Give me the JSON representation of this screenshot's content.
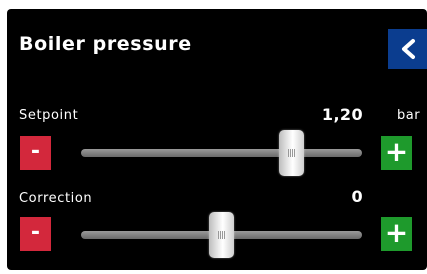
{
  "header": {
    "title": "Boiler pressure",
    "back_icon": "chevron-left-icon"
  },
  "params": [
    {
      "label": "Setpoint",
      "value": "1,20",
      "unit": "bar",
      "slider_fraction": 0.75,
      "minus_label": "-",
      "plus_label": "+"
    },
    {
      "label": "Correction",
      "value": "0",
      "unit": "",
      "slider_fraction": 0.5,
      "minus_label": "-",
      "plus_label": "+"
    }
  ],
  "colors": {
    "background": "#000000",
    "back_button": "#0b3d8f",
    "minus_button": "#d3283c",
    "plus_button": "#1e9a2c"
  }
}
